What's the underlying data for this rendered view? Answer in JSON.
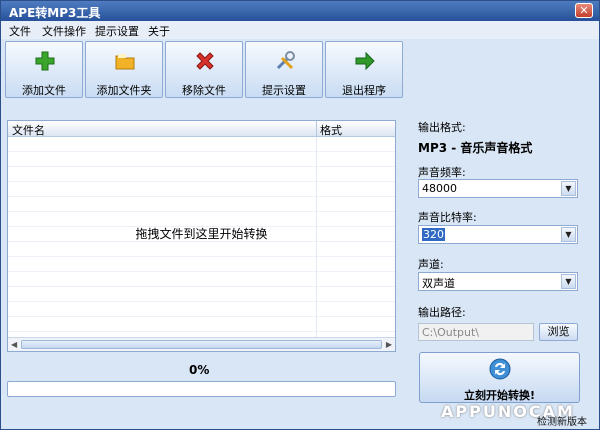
{
  "window": {
    "title": "APE转MP3工具",
    "close_glyph": "✕"
  },
  "menu": {
    "items": [
      "文件",
      "文件操作",
      "提示设置",
      "关于"
    ]
  },
  "toolbar": {
    "buttons": [
      {
        "label": "添加文件",
        "icon": "add-file-icon",
        "color": "#3aa52c"
      },
      {
        "label": "添加文件夹",
        "icon": "add-folder-icon",
        "color": "#f2b227"
      },
      {
        "label": "移除文件",
        "icon": "remove-icon",
        "color": "#d6322b"
      },
      {
        "label": "提示设置",
        "icon": "settings-tools-icon",
        "color": "#5c7fb0"
      },
      {
        "label": "退出程序",
        "icon": "exit-arrow-icon",
        "color": "#2f9a2a"
      }
    ]
  },
  "file_list": {
    "columns": [
      "文件名",
      "格式"
    ],
    "empty_hint": "拖拽文件到这里开始转换"
  },
  "progress": {
    "percent_label": "0%",
    "value": 0
  },
  "settings": {
    "output_format_label": "输出格式:",
    "output_format_value": "MP3 - 音乐声音格式",
    "sample_rate_label": "声音频率:",
    "sample_rate_value": "48000",
    "bitrate_label": "声音比特率:",
    "bitrate_value": "320",
    "channel_label": "声道:",
    "channel_value": "双声道",
    "output_path_label": "输出路径:",
    "output_path_value": "C:\\Output\\",
    "browse_label": "浏览"
  },
  "start_button": {
    "label": "立刻开始转换!"
  },
  "footer": {
    "watermark": "APPUNOCAM",
    "check_update": "检测新版本"
  },
  "colors": {
    "window_bg": "#d9e6f5",
    "title_bg": "#26519a",
    "selection": "#316ac5"
  }
}
